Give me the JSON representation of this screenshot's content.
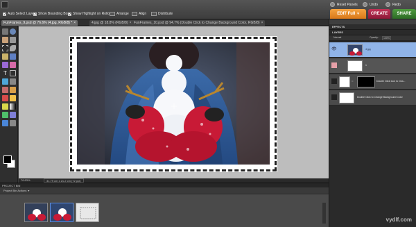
{
  "topbar": {
    "options": [
      {
        "label": "Auto Select Layer",
        "checked": true
      },
      {
        "label": "Show Bounding Box",
        "checked": true
      },
      {
        "label": "Show Highlight on Rollover",
        "checked": true
      }
    ],
    "arrange_label": "Arrange",
    "align_label": "Align",
    "distribute_label": "Distribute",
    "reset_panels_label": "Reset Panels",
    "undo_label": "Undo",
    "redo_label": "Redo"
  },
  "modes": {
    "edit_label": "EDIT Full",
    "create_label": "CREATE",
    "share_label": "SHARE",
    "colors": {
      "edit": "#e88a2b",
      "create": "#a7254a",
      "share": "#3e8a33"
    }
  },
  "doc_tabs": [
    {
      "label": "FunFrames_9.psd @ 76.6% (4.jpg, RGB/8) *",
      "active": true
    },
    {
      "label": "4.jpg @ 18.8% (RGB/8)",
      "active": false
    },
    {
      "label": "FunFrames_10.psd @ 94.7% (Double Click to Change Background Color, RGB/8)",
      "active": false
    }
  ],
  "status": {
    "zoom": "76.63%",
    "doc_size": "31.79 cm x 21.2 cm (72 ppi)"
  },
  "project_bin": {
    "title": "PROJECT BIN",
    "actions_label": "Project Bin Actions"
  },
  "right_panel": {
    "effects_title": "EFFECTS",
    "layers_title": "LAYERS",
    "blend_mode": "Normal",
    "opacity_label": "Opacity:",
    "opacity_value": "100%",
    "layers": [
      {
        "name": "4.jpg",
        "selected": true
      },
      {
        "name": "1",
        "selected": false
      },
      {
        "name": "Double Click Icon to Cha...",
        "selected": false
      },
      {
        "name": "Double Click to Change Background Color",
        "selected": false
      }
    ]
  },
  "watermark": "vydlf.com"
}
